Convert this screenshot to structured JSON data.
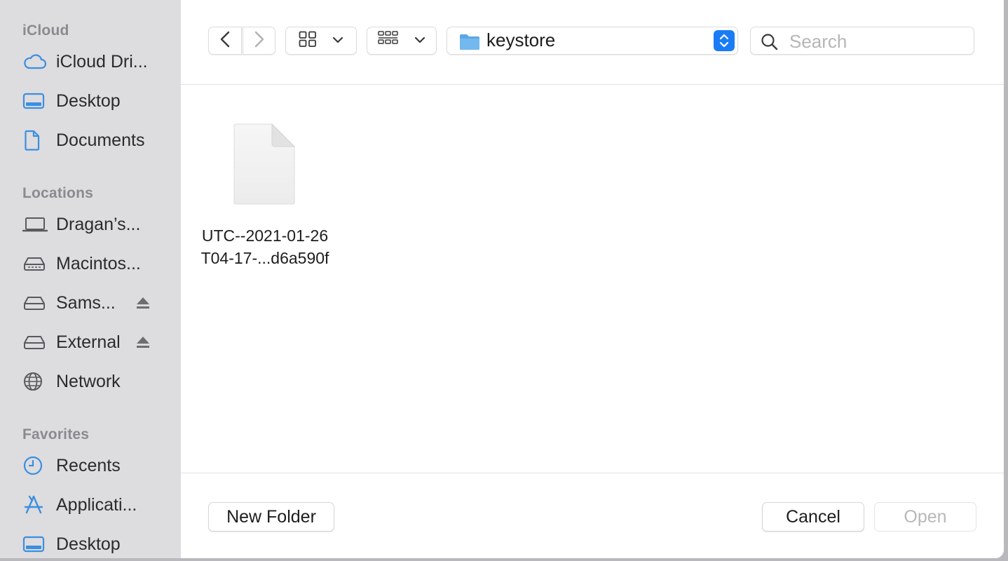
{
  "sidebar": {
    "sections": [
      {
        "title": "iCloud"
      },
      {
        "title": "Locations"
      },
      {
        "title": "Favorites"
      }
    ],
    "items": [
      {
        "label": "iCloud Dri...",
        "icon": "cloud-icon"
      },
      {
        "label": "Desktop",
        "icon": "desktop-icon"
      },
      {
        "label": "Documents",
        "icon": "document-icon"
      },
      {
        "label": "Dragan’s...",
        "icon": "laptop-icon"
      },
      {
        "label": "Macintos...",
        "icon": "drive-icon"
      },
      {
        "label": "Sams...",
        "icon": "drive-icon",
        "ejectable": true
      },
      {
        "label": "External",
        "icon": "drive-icon",
        "ejectable": true
      },
      {
        "label": "Network",
        "icon": "globe-icon"
      },
      {
        "label": "Recents",
        "icon": "clock-icon"
      },
      {
        "label": "Applicati...",
        "icon": "applications-icon"
      },
      {
        "label": "Desktop",
        "icon": "desktop-icon"
      }
    ]
  },
  "toolbar": {
    "location": "keystore",
    "search_placeholder": "Search"
  },
  "files": [
    {
      "name_line1": "UTC--2021-01-26",
      "name_line2": "T04-17-...d6a590f"
    }
  ],
  "footer": {
    "new_folder_label": "New Folder",
    "cancel_label": "Cancel",
    "open_label": "Open"
  },
  "colors": {
    "accent": "#1a7cf5",
    "sidebar_bg": "#dddcdf",
    "folder_blue": "#5aa7e6",
    "icon_blue": "#3b8fe0"
  }
}
